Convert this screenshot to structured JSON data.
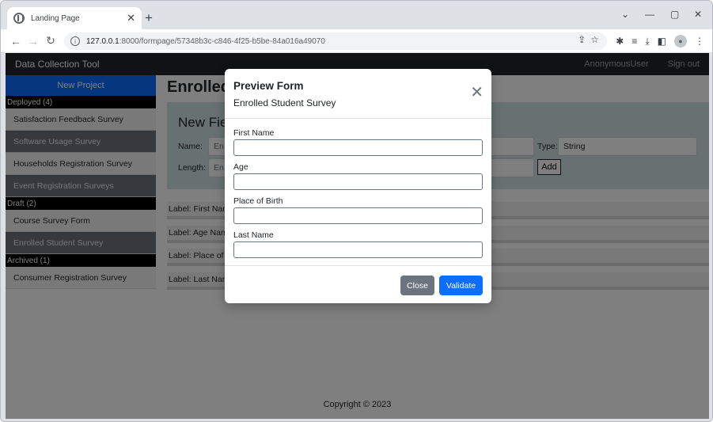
{
  "browser": {
    "tab_title": "Landing Page",
    "url_host": "127.0.0.1",
    "url_rest": ":8000/formpage/57348b3c-c846-4f25-b5be-84a016a49070"
  },
  "appbar": {
    "brand": "Data Collection Tool",
    "user": "AnonymousUser",
    "signout": "Sign out"
  },
  "sidebar": {
    "new_project": "New Project",
    "sections": [
      {
        "heading": "Deployed (4)",
        "items": [
          "Satisfaction Feedback Survey",
          "Software Usage Survey",
          "Households Registration Survey",
          "Event Registration Surveys"
        ]
      },
      {
        "heading": "Draft (2)",
        "items": [
          "Course Survey Form",
          "Enrolled Student Survey"
        ]
      },
      {
        "heading": "Archived (1)",
        "items": [
          "Consumer Registration Survey"
        ]
      }
    ]
  },
  "main": {
    "title_partial": "Enrolled",
    "new_field_title": "New Fie",
    "name_label": "Name:",
    "name_placeholder": "En",
    "type_label": "Type:",
    "type_value": "String",
    "length_label": "Length:",
    "length_placeholder": "En",
    "add_button": "Add",
    "labels": [
      "Label: First Nam",
      "Label: Age Nam",
      "Label: Place of B",
      "Label: Last Nam"
    ]
  },
  "footer": "Copyright © 2023",
  "modal": {
    "title": "Preview Form",
    "subtitle": "Enrolled Student Survey",
    "fields": [
      "First Name",
      "Age",
      "Place of Birth",
      "Last Name"
    ],
    "close_button": "Close",
    "validate_button": "Validate"
  }
}
